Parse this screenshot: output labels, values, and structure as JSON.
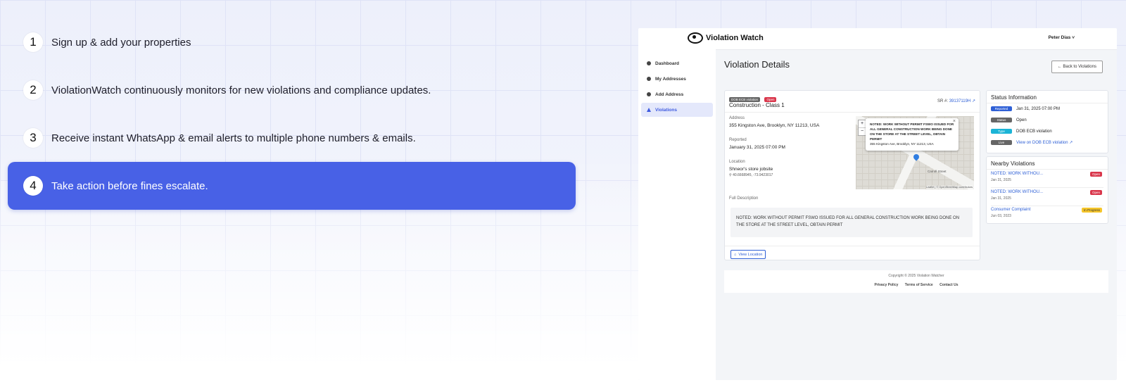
{
  "steps": [
    {
      "num": "1",
      "text": "Sign up & add your properties"
    },
    {
      "num": "2",
      "text": "ViolationWatch continuously monitors for new violations and compliance updates."
    },
    {
      "num": "3",
      "text": "Receive instant WhatsApp & email alerts to multiple phone numbers & emails."
    },
    {
      "num": "4",
      "text": "Take action before fines escalate."
    }
  ],
  "app": {
    "brand": "Violation Watch",
    "user": "Peter Dias ˅",
    "nav": [
      "Dashboard",
      "My Addresses",
      "Add Address",
      "Violations"
    ],
    "page_title": "Violation Details",
    "back": "← Back to Violations",
    "violation": {
      "badge_type": "DOB ECB violation",
      "badge_status": "Open",
      "title": "Construction - Class 1",
      "sr_label": "SR #:",
      "sr_value": "39137119H ↗",
      "address_label": "Address",
      "address": "355 Kingston Ave, Brooklyn, NY 11213, USA",
      "reported_label": "Reported",
      "reported": "January 31, 2025 07:00 PM",
      "location_label": "Location",
      "location": "Shneor's store jobsite",
      "coords": "40.6668945, -73.9423017",
      "desc_label": "Full Description",
      "description": "NOTED: WORK WITHOUT PERMIT FSWO ISSUED FOR ALL GENERAL CONSTRUCTION WORK BEING DONE ON THE STORE AT THE STREET LEVEL, OBTAIN PERMIT",
      "view_location": "View Location"
    },
    "map": {
      "popup_text": "NOTED: WORK WITHOUT PERMIT FSWO ISSUED FOR ALL GENERAL CONSTRUCTION WORK BEING DONE ON THE STORE AT THE STREET LEVEL, OBTAIN PERMIT",
      "popup_address": "355 Kingston Ave, Brooklyn, NY 11213, USA",
      "zoom_in": "+",
      "zoom_out": "−",
      "close": "×",
      "street": "Carroll Street",
      "attribution": "Leaflet | © OpenStreetMap contributors"
    },
    "status": {
      "title": "Status Information",
      "rows": [
        {
          "badge": "Reported",
          "value": "Jan 31, 2025 07:00 PM"
        },
        {
          "badge": "Status",
          "value": "Open"
        },
        {
          "badge": "Type",
          "value": "DOB ECB violation"
        },
        {
          "badge": "Live",
          "value": "View on DOB ECB violation ↗"
        }
      ]
    },
    "nearby": {
      "title": "Nearby Violations",
      "items": [
        {
          "title": "NOTED: WORK WITHOU...",
          "date": "Jan 31, 2025",
          "badge": "Open"
        },
        {
          "title": "NOTED: WORK WITHOU...",
          "date": "Jan 31, 2025",
          "badge": "Open"
        },
        {
          "title": "Consumer Complaint",
          "date": "Jun 03, 2023",
          "badge": "In Progress"
        }
      ]
    },
    "footer": {
      "copyright": "Copyright © 2025 Violation Watcher",
      "links": [
        "Privacy Policy",
        "Terms of Service",
        "Contact Us"
      ]
    }
  }
}
